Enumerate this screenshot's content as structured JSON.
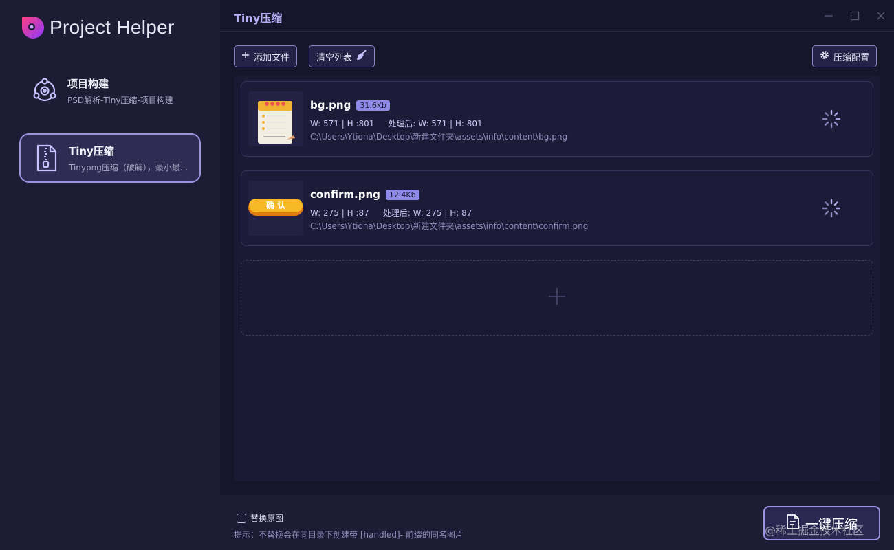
{
  "app": {
    "brand": "Project Helper"
  },
  "sidebar": {
    "items": [
      {
        "title": "项目构建",
        "subtitle": "PSD解析-Tiny压缩-项目构建",
        "icon": "gear-network-icon",
        "active": false
      },
      {
        "title": "Tiny压缩",
        "subtitle": "Tinypng压缩（破解），最小最...",
        "icon": "zip-file-icon",
        "active": true
      }
    ]
  },
  "window": {
    "title": "Tiny压缩"
  },
  "toolbar": {
    "add_label": "添加文件",
    "clear_label": "清空列表",
    "config_label": "压缩配置"
  },
  "files": [
    {
      "name": "bg.png",
      "size": "31.6Kb",
      "dims_before": "W: 571 | H :801",
      "dims_after": "处理后: W: 571 | H: 801",
      "path": "C:\\Users\\Ytiona\\Desktop\\新建文件夹\\assets\\info\\content\\bg.png"
    },
    {
      "name": "confirm.png",
      "size": "12.4Kb",
      "dims_before": "W: 275 | H :87",
      "dims_after": "处理后: W: 275 | H: 87",
      "path": "C:\\Users\\Ytiona\\Desktop\\新建文件夹\\assets\\info\\content\\confirm.png",
      "thumb_text": "确 认"
    }
  ],
  "footer": {
    "replace_label": "替换原图",
    "hint": "提示：不替换会在同目录下创建带 [handled]- 前缀的同名图片",
    "compress_label": "一键压缩",
    "watermark": "@稀土掘金技术社区"
  },
  "colors": {
    "accent": "#9a94e0",
    "badge": "#8f8ae8",
    "title": "#b4aef5"
  }
}
